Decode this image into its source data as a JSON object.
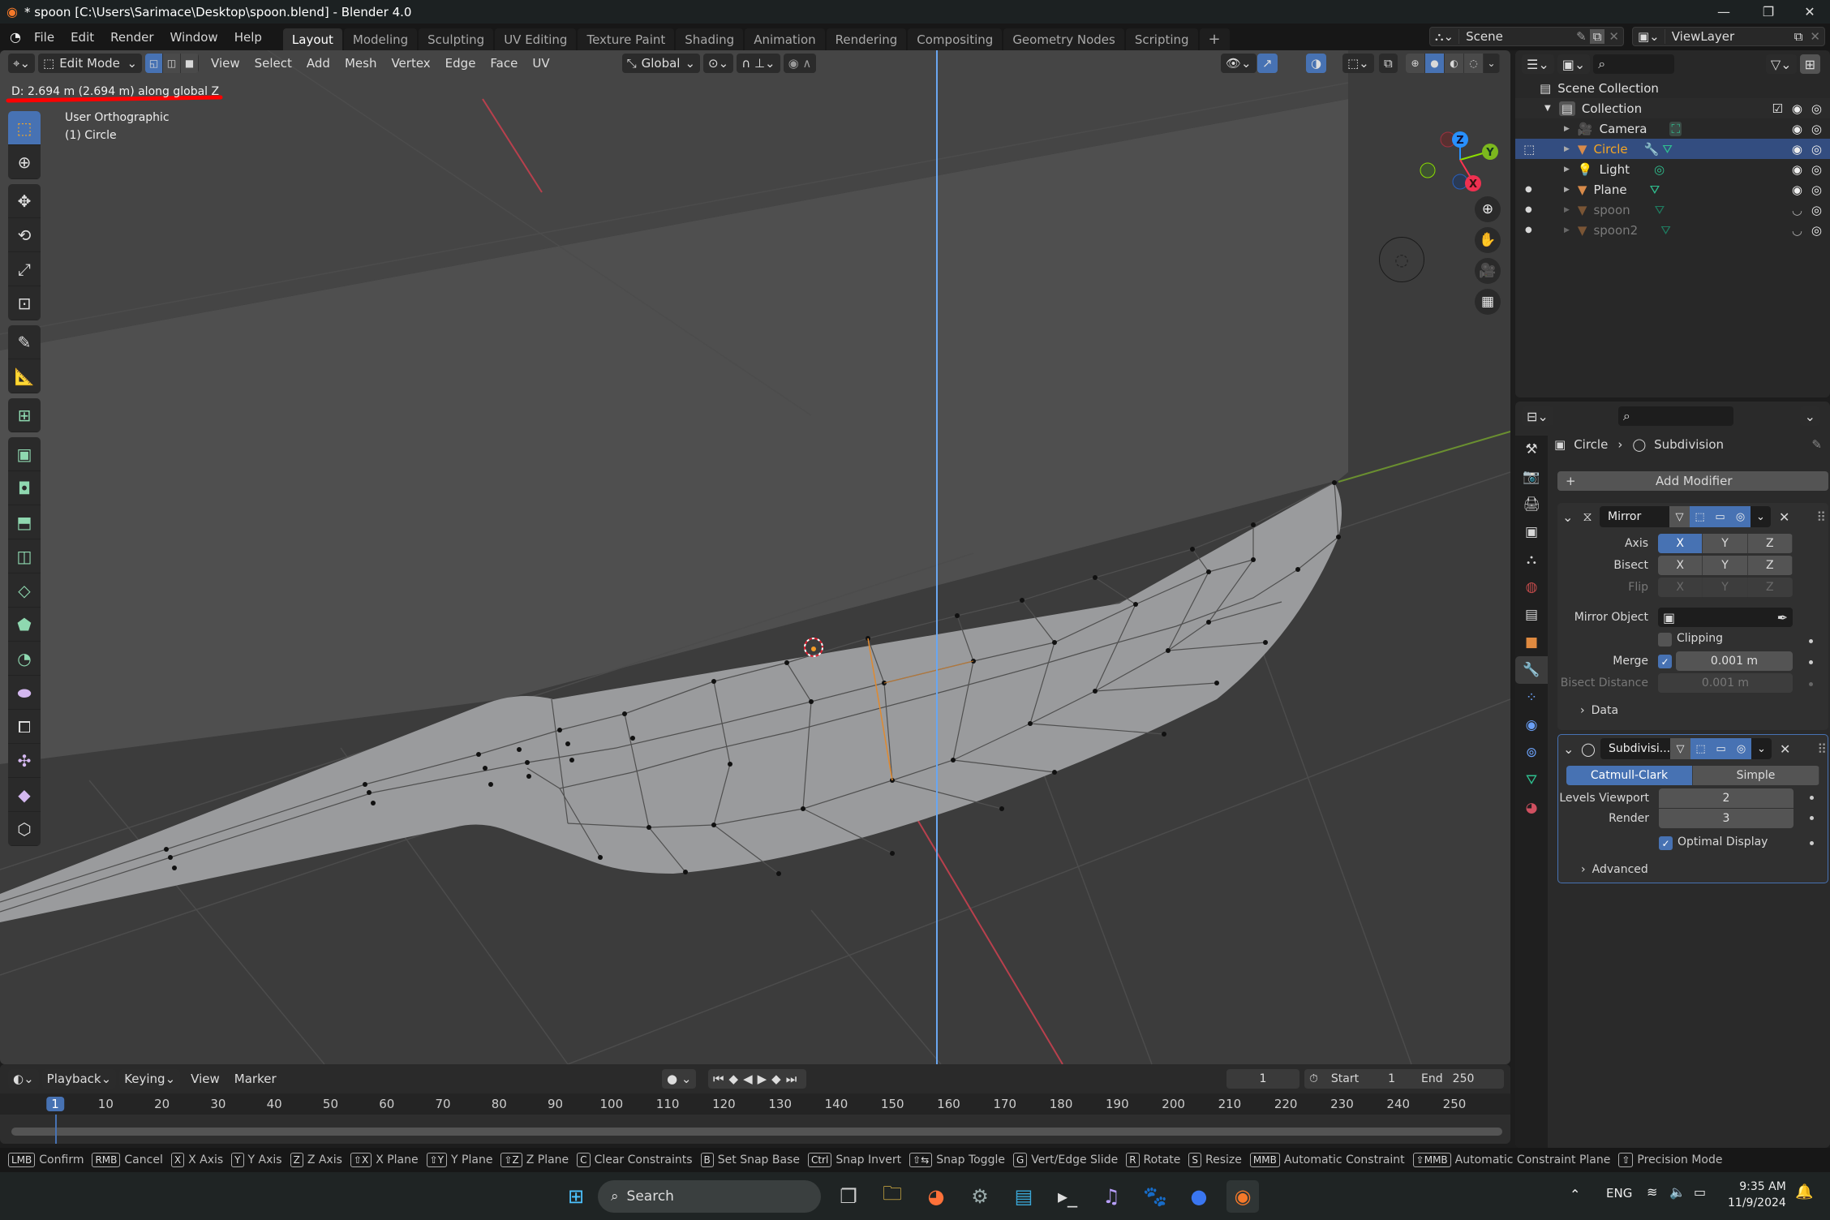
{
  "window": {
    "title": "* spoon [C:\\Users\\Sarimace\\Desktop\\spoon.blend] - Blender 4.0",
    "minimize": "—",
    "maximize": "❐",
    "close": "✕"
  },
  "menu": {
    "items": [
      "File",
      "Edit",
      "Render",
      "Window",
      "Help"
    ],
    "workspaces": [
      "Layout",
      "Modeling",
      "Sculpting",
      "UV Editing",
      "Texture Paint",
      "Shading",
      "Animation",
      "Rendering",
      "Compositing",
      "Geometry Nodes",
      "Scripting"
    ],
    "active_workspace": "Layout",
    "add_workspace": "+",
    "scene": "Scene",
    "view_layer": "ViewLayer"
  },
  "viewport": {
    "mode": "Edit Mode",
    "menus": [
      "View",
      "Select",
      "Add",
      "Mesh",
      "Vertex",
      "Edge",
      "Face",
      "UV"
    ],
    "orientation": "Global",
    "operator_status": "D: 2.694 m (2.694 m) along global Z",
    "view_name": "User Orthographic",
    "object_label": "(1) Circle",
    "gizmo_axes": [
      "Z",
      "Y",
      "X"
    ],
    "nav_buttons": [
      "zoom-icon",
      "pan-hand-icon",
      "camera-view-icon",
      "grid-ortho-icon"
    ],
    "tools": [
      "select-box",
      "cursor",
      "move",
      "rotate",
      "scale",
      "transform",
      "annotate",
      "measure",
      "add-cube",
      "extrude-region",
      "inset-faces",
      "bevel",
      "loop-cut",
      "knife",
      "poly-build",
      "spin",
      "smooth",
      "edge-slide",
      "shrink-fatten",
      "shear",
      "rip-region"
    ],
    "colors": {
      "x_axis": "#ff3352",
      "y_axis": "#8bdc00",
      "z_axis": "#2890ff",
      "accent": "#4772b3",
      "mesh": "#9a9b9d",
      "background": "#3c3c3c"
    }
  },
  "outliner": {
    "root": "Scene Collection",
    "collection": "Collection",
    "objects": [
      {
        "name": "Camera",
        "type": "camera",
        "visible": true,
        "selected": false
      },
      {
        "name": "Circle",
        "type": "mesh",
        "visible": true,
        "selected": true,
        "has_modifier": true
      },
      {
        "name": "Light",
        "type": "light",
        "visible": true,
        "selected": false
      },
      {
        "name": "Plane",
        "type": "mesh",
        "visible": true,
        "selected": false
      },
      {
        "name": "spoon",
        "type": "mesh",
        "visible": false,
        "selected": false
      },
      {
        "name": "spoon2",
        "type": "mesh",
        "visible": false,
        "selected": false
      }
    ]
  },
  "properties": {
    "breadcrumb_object": "Circle",
    "breadcrumb_modifier": "Subdivision",
    "add_modifier": "Add Modifier",
    "mirror": {
      "name": "Mirror",
      "axis_label": "Axis",
      "bisect_label": "Bisect",
      "flip_label": "Flip",
      "axes": [
        "X",
        "Y",
        "Z"
      ],
      "axis_active": "X",
      "mirror_object_label": "Mirror Object",
      "clipping_label": "Clipping",
      "clipping": false,
      "merge_label": "Merge",
      "merge_enabled": true,
      "merge_value": "0.001 m",
      "bisect_distance_label": "Bisect Distance",
      "bisect_distance_value": "0.001 m",
      "data_label": "Data"
    },
    "subdivision": {
      "name": "Subdivisi...",
      "mode_options": [
        "Catmull-Clark",
        "Simple"
      ],
      "mode_active": "Catmull-Clark",
      "levels_viewport_label": "Levels Viewport",
      "levels_viewport": "2",
      "render_label": "Render",
      "render": "3",
      "optimal_display_label": "Optimal Display",
      "optimal_display": true,
      "advanced_label": "Advanced"
    }
  },
  "timeline": {
    "menus": [
      "Playback",
      "Keying",
      "View",
      "Marker"
    ],
    "current_frame": "1",
    "start_label": "Start",
    "start": "1",
    "end_label": "End",
    "end": "250",
    "ruler_ticks": [
      "1",
      "10",
      "20",
      "30",
      "40",
      "50",
      "60",
      "70",
      "80",
      "90",
      "100",
      "110",
      "120",
      "130",
      "140",
      "150",
      "160",
      "170",
      "180",
      "190",
      "200",
      "210",
      "220",
      "230",
      "240",
      "250"
    ]
  },
  "statusbar": {
    "hints": [
      {
        "key": "LMB",
        "label": "Confirm"
      },
      {
        "key": "RMB",
        "label": "Cancel"
      },
      {
        "key": "X",
        "label": "X Axis"
      },
      {
        "key": "Y",
        "label": "Y Axis"
      },
      {
        "key": "Z",
        "label": "Z Axis"
      },
      {
        "key": "⇧X",
        "label": "X Plane"
      },
      {
        "key": "⇧Y",
        "label": "Y Plane"
      },
      {
        "key": "⇧Z",
        "label": "Z Plane"
      },
      {
        "key": "C",
        "label": "Clear Constraints"
      },
      {
        "key": "B",
        "label": "Set Snap Base"
      },
      {
        "key": "Ctrl",
        "label": "Snap Invert"
      },
      {
        "key": "⇧⇆",
        "label": "Snap Toggle"
      },
      {
        "key": "G",
        "label": "Vert/Edge Slide"
      },
      {
        "key": "R",
        "label": "Rotate"
      },
      {
        "key": "S",
        "label": "Resize"
      },
      {
        "key": "MMB",
        "label": "Automatic Constraint"
      },
      {
        "key": "⇧MMB",
        "label": "Automatic Constraint Plane"
      },
      {
        "key": "⇧",
        "label": "Precision Mode"
      }
    ]
  },
  "taskbar": {
    "search_placeholder": "Search",
    "apps": [
      "start",
      "task-view",
      "file-explorer",
      "firefox",
      "settings",
      "notepad",
      "terminal",
      "musescore",
      "gimp",
      "signal",
      "blender"
    ],
    "language": "ENG",
    "time": "9:35 AM",
    "date": "11/9/2024"
  }
}
